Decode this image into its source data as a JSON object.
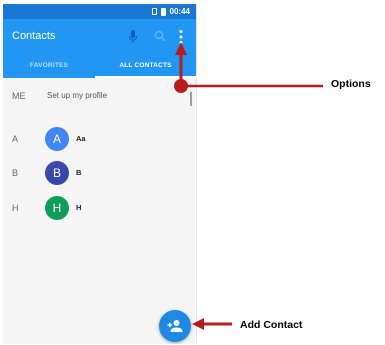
{
  "status_bar": {
    "time": "00:44"
  },
  "app_bar": {
    "title": "Contacts"
  },
  "tabs": [
    {
      "label": "FAVORITES"
    },
    {
      "label": "ALL CONTACTS"
    }
  ],
  "me": {
    "letter": "ME",
    "text": "Set up my profile"
  },
  "contacts": [
    {
      "section": "A",
      "initial": "A",
      "name": "Aa",
      "color": "#4285f4"
    },
    {
      "section": "B",
      "initial": "B",
      "name": "B",
      "color": "#3949ab"
    },
    {
      "section": "H",
      "initial": "H",
      "name": "H",
      "color": "#0f9d58"
    }
  ],
  "callouts": {
    "options": "Options",
    "add_contact": "Add Contact",
    "color": "#b71c1c"
  },
  "colors": {
    "app_bar": "#2196f3",
    "status_bar": "#1976d2",
    "fab": "#1e88e5"
  }
}
